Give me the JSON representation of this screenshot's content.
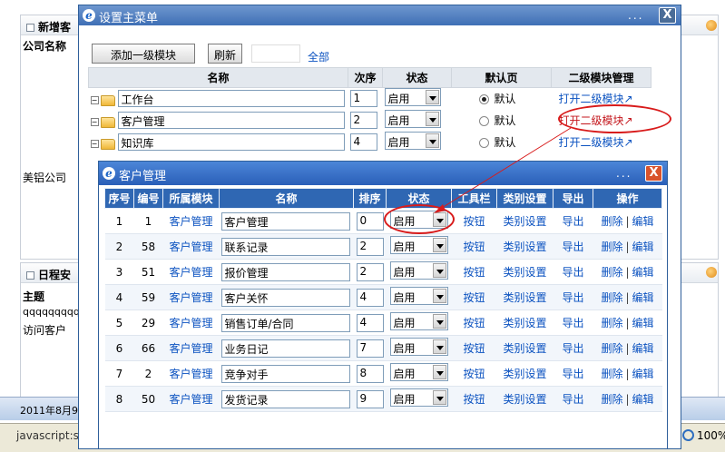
{
  "background": {
    "panel1_title": "新增客",
    "company_label": "公司名称",
    "company_value": "美铝公司",
    "panel2_title": "日程安",
    "subject_label": "主题",
    "item1": "qqqqqqqqq",
    "item2": "访问客户",
    "taskbar_date": "2011年8月9",
    "status_text": "javascript:se",
    "zoom": "100%"
  },
  "outer_dialog": {
    "title": "设置主菜单",
    "dots": "...",
    "close": "X",
    "add_button": "添加一级模块",
    "refresh_button": "刷新",
    "all_link": "全部",
    "columns": [
      "名称",
      "次序",
      "状态",
      "默认页",
      "二级模块管理"
    ],
    "rows": [
      {
        "name": "工作台",
        "order": "1",
        "status": "启用",
        "default_label": "默认",
        "selected": true,
        "link": "打开二级模块↗"
      },
      {
        "name": "客户管理",
        "order": "2",
        "status": "启用",
        "default_label": "默认",
        "selected": false,
        "link": "打开二级模块↗"
      },
      {
        "name": "知识库",
        "order": "4",
        "status": "启用",
        "default_label": "默认",
        "selected": false,
        "link": "打开二级模块↗"
      }
    ]
  },
  "inner_dialog": {
    "title": "客户管理",
    "dots": "...",
    "close": "X",
    "columns": [
      "序号",
      "编号",
      "所属模块",
      "名称",
      "排序",
      "状态",
      "工具栏",
      "类别设置",
      "导出",
      "操作"
    ],
    "rows": [
      {
        "seq": "1",
        "id": "1",
        "module": "客户管理",
        "name": "客户管理",
        "order": "0",
        "status": "启用",
        "toolbar": "按钮",
        "category": "类别设置",
        "export": "导出",
        "delete": "删除",
        "edit": "编辑"
      },
      {
        "seq": "2",
        "id": "58",
        "module": "客户管理",
        "name": "联系记录",
        "order": "2",
        "status": "启用",
        "toolbar": "按钮",
        "category": "类别设置",
        "export": "导出",
        "delete": "删除",
        "edit": "编辑"
      },
      {
        "seq": "3",
        "id": "51",
        "module": "客户管理",
        "name": "报价管理",
        "order": "2",
        "status": "启用",
        "toolbar": "按钮",
        "category": "类别设置",
        "export": "导出",
        "delete": "删除",
        "edit": "编辑"
      },
      {
        "seq": "4",
        "id": "59",
        "module": "客户管理",
        "name": "客户关怀",
        "order": "4",
        "status": "启用",
        "toolbar": "按钮",
        "category": "类别设置",
        "export": "导出",
        "delete": "删除",
        "edit": "编辑"
      },
      {
        "seq": "5",
        "id": "29",
        "module": "客户管理",
        "name": "销售订单/合同",
        "order": "4",
        "status": "启用",
        "toolbar": "按钮",
        "category": "类别设置",
        "export": "导出",
        "delete": "删除",
        "edit": "编辑"
      },
      {
        "seq": "6",
        "id": "66",
        "module": "客户管理",
        "name": "业务日记",
        "order": "7",
        "status": "启用",
        "toolbar": "按钮",
        "category": "类别设置",
        "export": "导出",
        "delete": "删除",
        "edit": "编辑"
      },
      {
        "seq": "7",
        "id": "2",
        "module": "客户管理",
        "name": "竞争对手",
        "order": "8",
        "status": "启用",
        "toolbar": "按钮",
        "category": "类别设置",
        "export": "导出",
        "delete": "删除",
        "edit": "编辑"
      },
      {
        "seq": "8",
        "id": "50",
        "module": "客户管理",
        "name": "发货记录",
        "order": "9",
        "status": "启用",
        "toolbar": "按钮",
        "category": "类别设置",
        "export": "导出",
        "delete": "删除",
        "edit": "编辑"
      }
    ],
    "separator": "|"
  },
  "colors": {
    "link": "#0b52c0",
    "header_blue": "#2f67b3",
    "annotation_red": "#d81b1b"
  }
}
